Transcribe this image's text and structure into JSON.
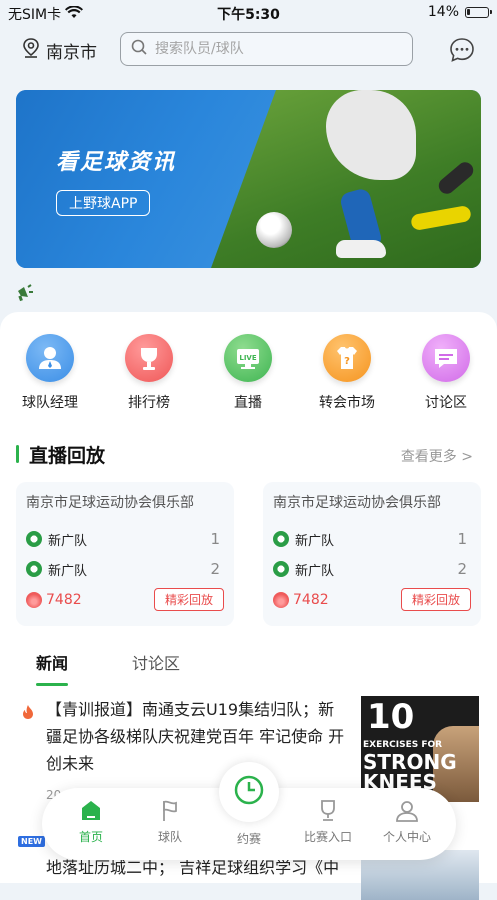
{
  "status": {
    "carrier": "无SIM卡",
    "time": "下午5:30",
    "battery": "14%"
  },
  "header": {
    "city": "南京市",
    "search_placeholder": "搜索队员/球队"
  },
  "banner": {
    "title": "看足球资讯",
    "subtitle": "上野球APP"
  },
  "quick": [
    {
      "label": "球队经理",
      "color": "#3b8ee6",
      "icon": "manager-icon"
    },
    {
      "label": "排行榜",
      "color": "#ef5757",
      "icon": "trophy-icon"
    },
    {
      "label": "直播",
      "color": "#3fb552",
      "icon": "live-tv-icon"
    },
    {
      "label": "转会市场",
      "color": "#f5941f",
      "icon": "jersey-icon"
    },
    {
      "label": "讨论区",
      "color": "#d16be8",
      "icon": "comment-icon"
    }
  ],
  "live": {
    "title": "直播回放",
    "more": "查看更多 >",
    "cards": [
      {
        "club": "南京市足球运动协会俱乐部",
        "team1": "新广队",
        "score1": "1",
        "team2": "新广队",
        "score2": "2",
        "heat": "7482",
        "button": "精彩回放"
      },
      {
        "club": "南京市足球运动协会俱乐部",
        "team1": "新广队",
        "score1": "1",
        "team2": "新广队",
        "score2": "2",
        "heat": "7482",
        "button": "精彩回放"
      }
    ]
  },
  "tabs": [
    "新闻",
    "讨论区"
  ],
  "news": [
    {
      "text": "【青训报道】南通支云U19集结归队；新疆足协各级梯队庆祝建党百年 牢记使命 开创未来",
      "date": "20",
      "thumb": {
        "n": "10",
        "a": "EXERCISES FOR",
        "b": "STRONG",
        "c": "KNEES"
      }
    },
    {
      "badge": "NEW",
      "text": "地落址历城二中； 吉祥足球组织学习《中"
    }
  ],
  "nav": [
    {
      "label": "首页"
    },
    {
      "label": "球队"
    },
    {
      "label": "约赛"
    },
    {
      "label": "比赛入口"
    },
    {
      "label": "个人中心"
    }
  ],
  "colors": {
    "accent": "#2bb24c",
    "hot": "#e94c4c"
  }
}
